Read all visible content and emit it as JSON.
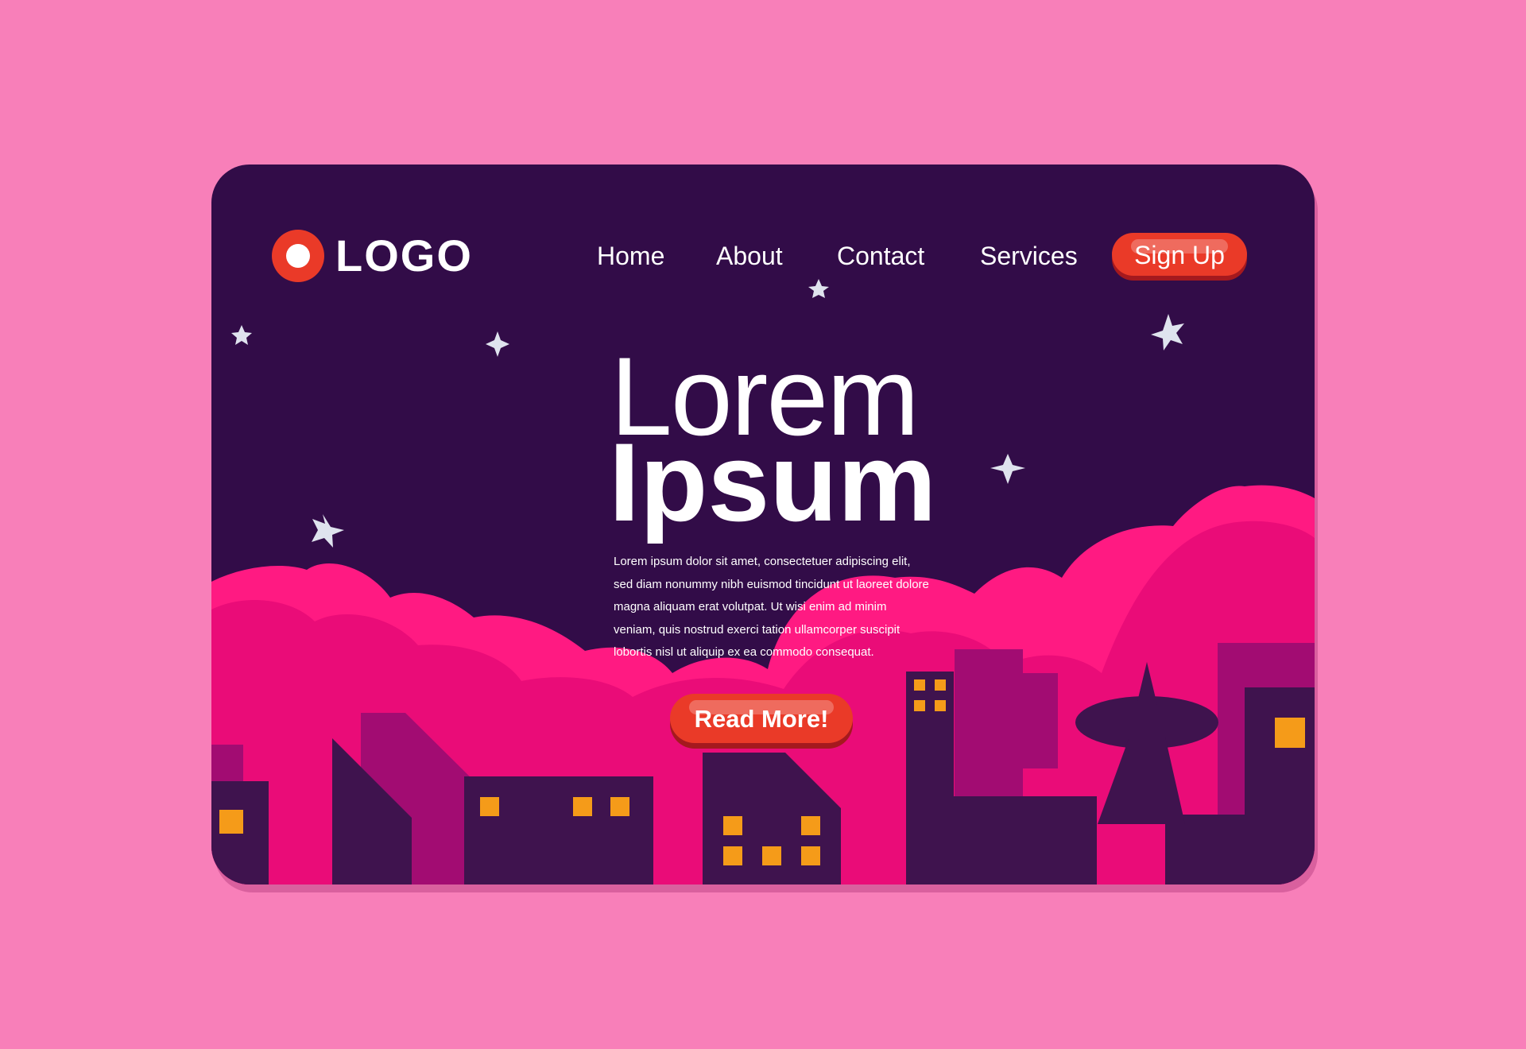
{
  "colors": {
    "page_background": "#f87fb9",
    "card_background": "#320c48",
    "accent": "#ea3a28",
    "clouds": [
      "#ff1a82",
      "#ea0c78"
    ],
    "buildings": [
      "#a20c72",
      "#3f134e"
    ],
    "windows": "#f59b19",
    "stars": "#dfe3ee"
  },
  "logo": {
    "text": "LOGO",
    "icon": "circle-logo-icon"
  },
  "nav": {
    "items": [
      {
        "label": "Home"
      },
      {
        "label": "About"
      },
      {
        "label": "Contact"
      },
      {
        "label": "Services"
      }
    ],
    "signup_label": "Sign Up"
  },
  "hero": {
    "title_light": "Lorem",
    "title_bold": "Ipsum",
    "paragraph": "Lorem ipsum dolor sit amet, consectetuer adipiscing elit, sed diam nonummy nibh euismod tincidunt ut laoreet dolore magna aliquam erat volutpat. Ut wisi enim ad minim veniam, quis nostrud exerci tation ullamcorper suscipit lobortis nisl ut aliquip ex ea commodo consequat.",
    "cta_label": "Read More!"
  },
  "illustration": {
    "elements": [
      "star-icon",
      "cloud",
      "building",
      "window",
      "water-tower"
    ]
  }
}
